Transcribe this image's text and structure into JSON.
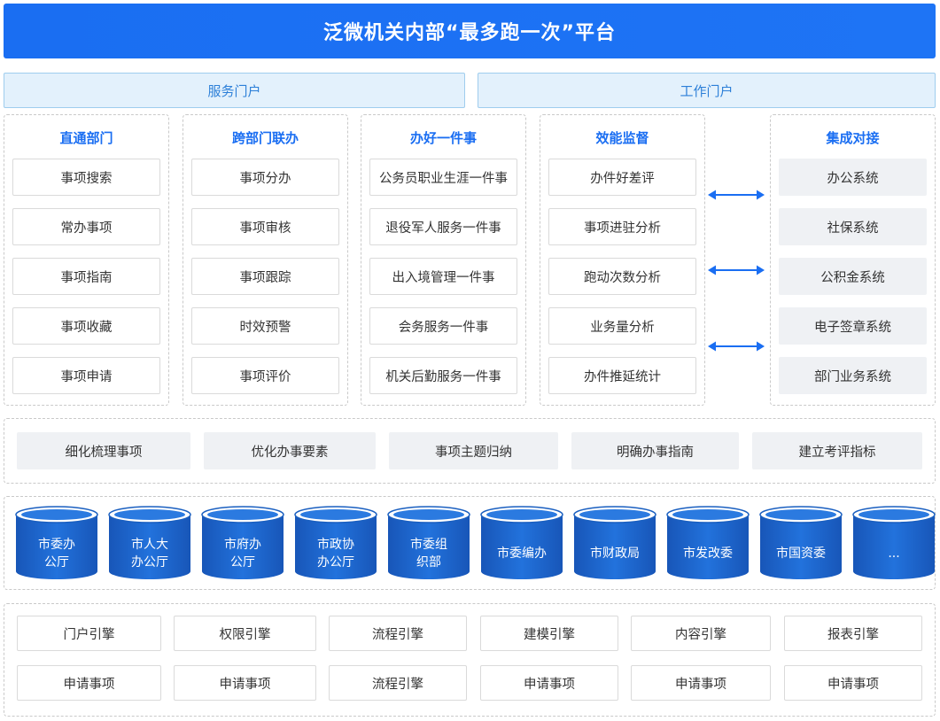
{
  "title": "泛微机关内部“最多跑一次”平台",
  "portals": {
    "service": "服务门户",
    "work": "工作门户"
  },
  "columns": [
    {
      "title": "直通部门",
      "items": [
        "事项搜索",
        "常办事项",
        "事项指南",
        "事项收藏",
        "事项申请"
      ]
    },
    {
      "title": "跨部门联办",
      "items": [
        "事项分办",
        "事项审核",
        "事项跟踪",
        "时效预警",
        "事项评价"
      ]
    },
    {
      "title": "办好一件事",
      "items": [
        "公务员职业生涯一件事",
        "退役军人服务一件事",
        "出入境管理一件事",
        "会务服务一件事",
        "机关后勤服务一件事"
      ]
    },
    {
      "title": "效能监督",
      "items": [
        "办件好差评",
        "事项进驻分析",
        "跑动次数分析",
        "业务量分析",
        "办件推延统计"
      ]
    }
  ],
  "integration": {
    "title": "集成对接",
    "items": [
      "办公系统",
      "社保系统",
      "公积金系统",
      "电子签章系统",
      "部门业务系统"
    ]
  },
  "process": [
    "细化梳理事项",
    "优化办事要素",
    "事项主题归纳",
    "明确办事指南",
    "建立考评指标"
  ],
  "departments": [
    "市委办\n公厅",
    "市人大\n办公厅",
    "市府办\n公厅",
    "市政协\n办公厅",
    "市委组\n织部",
    "市委编办",
    "市财政局",
    "市发改委",
    "市国资委",
    "..."
  ],
  "engines": [
    [
      "门户引擎",
      "权限引擎",
      "流程引擎",
      "建模引擎",
      "内容引擎",
      "报表引擎"
    ],
    [
      "申请事项",
      "申请事项",
      "流程引擎",
      "申请事项",
      "申请事项",
      "申请事项"
    ]
  ],
  "colors": {
    "primary": "#1a6ef2",
    "portal_bg": "#e3f1fc",
    "cylinder": "#1a5fc0"
  }
}
